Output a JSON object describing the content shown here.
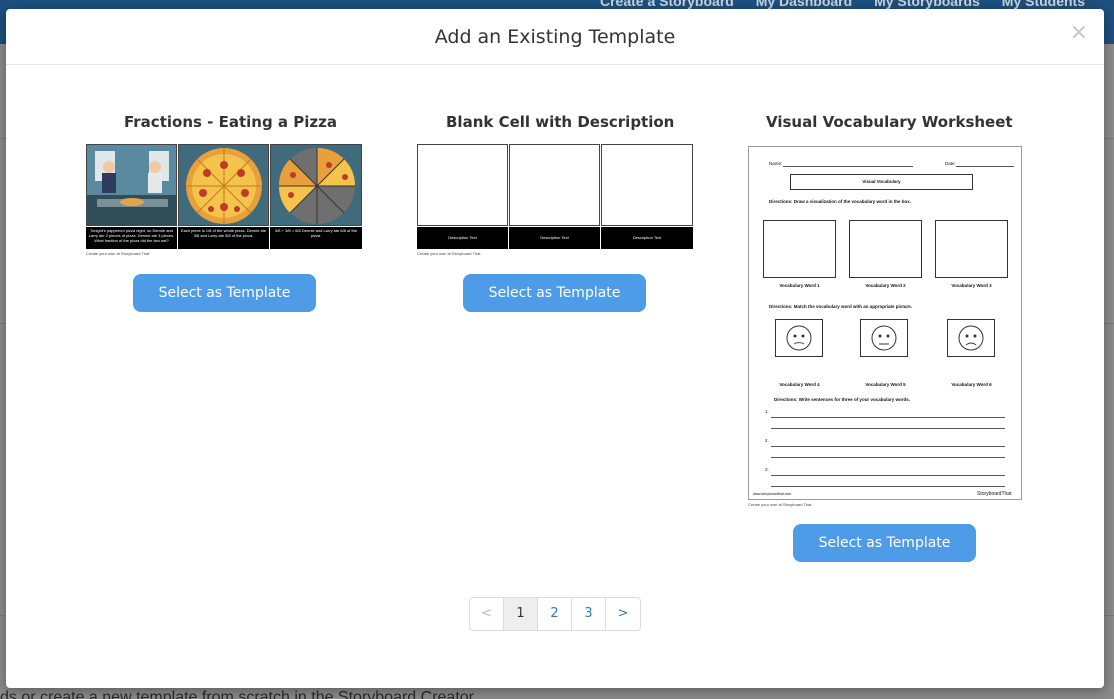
{
  "background": {
    "nav_items": [
      "Create a Storyboard",
      "My Dashboard",
      "My Storyboards",
      "My Students"
    ],
    "footer_text": "ds or create a new template from scratch in the Storyboard Creator."
  },
  "modal": {
    "title": "Add an Existing Template",
    "close_symbol": "×"
  },
  "templates": [
    {
      "title": "Fractions - Eating a Pizza",
      "button_label": "Select as Template",
      "cell_captions": [
        "Tonight's papperoni pizza night, so Dennie and Larry ate 2 pieces of pizza. Dennie ate 3 pieces. What fraction of the pizza did the two eat?",
        "Each piece is 1/8 of the whole pizza. Dennie ate 3/8 and Larry ate 3/8 of the pizza.",
        "3/8 + 3/8 = 6/8 Dennie and Larry ate 6/8 of the pizza."
      ],
      "credit": "Create your own at Storyboard That"
    },
    {
      "title": "Blank Cell with Description",
      "button_label": "Select as Template",
      "cell_captions": [
        "Description Text",
        "Description Text",
        "Description Text"
      ],
      "credit": "Create your own at Storyboard That"
    },
    {
      "title": "Visual Vocabulary Worksheet",
      "button_label": "Select as Template",
      "worksheet": {
        "name_label": "Name:",
        "date_label": "Date:",
        "heading": "Visual Vocabulary",
        "directions1": "Directions: Draw a visualization of the vocabulary word in the box.",
        "words_top": [
          "Vocabulary Word 1",
          "Vocabulary Word 2",
          "Vocabulary Word 3"
        ],
        "directions2": "Directions: Match the vocabulary word with an appropriate picture.",
        "words_bottom": [
          "Vocabulary Word 4",
          "Vocabulary Word 5",
          "Vocabulary Word 6"
        ],
        "directions3": "Directions: Write sentences for three of your vocabulary words.",
        "numbers": [
          "1.",
          "2.",
          "3."
        ],
        "footer_left": "www.storyboardthat.com",
        "footer_brand": "StoryboardThat"
      },
      "credit": "Create your own at Storyboard That"
    }
  ],
  "pagination": {
    "prev": "<",
    "pages": [
      "1",
      "2",
      "3"
    ],
    "active_page": "1",
    "next": ">"
  }
}
